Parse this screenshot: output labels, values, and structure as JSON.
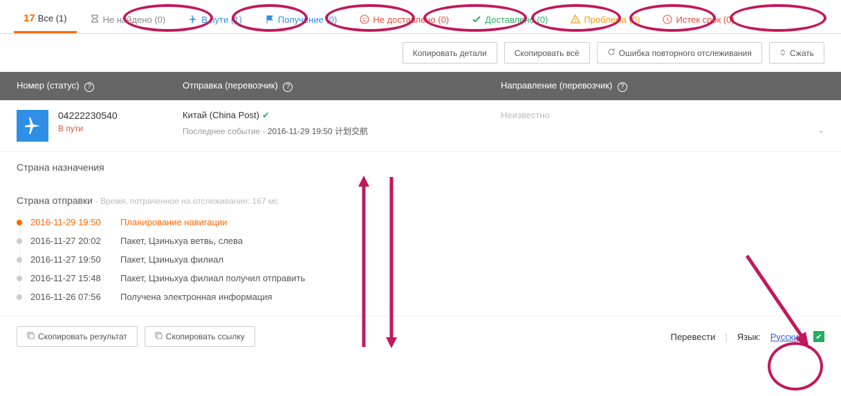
{
  "tabs": {
    "all": {
      "label": "Все (1)"
    },
    "notfound": {
      "label": "Не найдено (0)"
    },
    "transit": {
      "label": "В пути (1)"
    },
    "pickup": {
      "label": "Получение (0)"
    },
    "undelivered": {
      "label": "Не доставлено (0)"
    },
    "delivered": {
      "label": "Доставлено (0)"
    },
    "alert": {
      "label": "Проблема (0)"
    },
    "expired": {
      "label": "Истек срок (0)"
    }
  },
  "actions": {
    "copy_details": "Копировать детали",
    "copy_all": "Скопировать всё",
    "retrack_error": "Ошибка повторного отслеживания",
    "collapse": "Сжать"
  },
  "header": {
    "number": "Номер (статус)",
    "shipment": "Отправка (перевозчик)",
    "destination": "Направление (перевозчик)"
  },
  "track": {
    "number": "04222230540",
    "status": "В пути",
    "carrier": "Китай (China Post)",
    "last_event_label": "Последнее событие -",
    "last_event_value": "2016-11-29 19:50 计划交航",
    "destination": "Неизвестно"
  },
  "details": {
    "dest_country": "Страна назначения",
    "origin_country": "Страна отправки",
    "time_spent": "- Время, потраченное на отслеживание: 167 мс",
    "events": [
      {
        "date": "2016-11-29 19:50",
        "text": "Планирование навигации",
        "latest": true
      },
      {
        "date": "2016-11-27 20:02",
        "text": "Пакет, Цзиньхуа ветвь, слева",
        "latest": false
      },
      {
        "date": "2016-11-27 19:50",
        "text": "Пакет, Цзиньхуа филиал",
        "latest": false
      },
      {
        "date": "2016-11-27 15:48",
        "text": "Пакет, Цзиньхуа филиал получил отправить",
        "latest": false
      },
      {
        "date": "2016-11-26 07:56",
        "text": "Получена электронная информация",
        "latest": false
      }
    ]
  },
  "footer": {
    "copy_result": "Скопировать результат",
    "copy_link": "Скопировать ссылку",
    "translate": "Перевести",
    "lang_label": "Язык:",
    "lang_value": "Русский"
  }
}
